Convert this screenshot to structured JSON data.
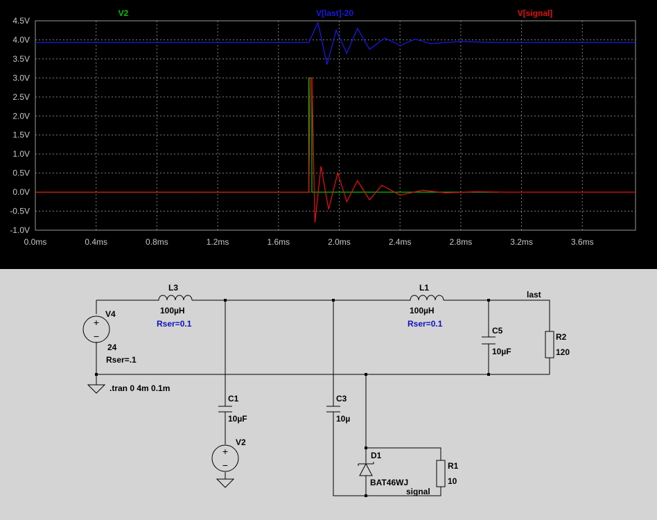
{
  "waveform": {
    "traces": [
      {
        "name": "V2",
        "color": "#00c000"
      },
      {
        "name": "V[last]-20",
        "color": "#1818e0"
      },
      {
        "name": "V[signal]",
        "color": "#e01010"
      }
    ],
    "y_ticks": [
      "4.5V",
      "4.0V",
      "3.5V",
      "3.0V",
      "2.5V",
      "2.0V",
      "1.5V",
      "1.0V",
      "0.5V",
      "0.0V",
      "-0.5V",
      "-1.0V"
    ],
    "x_ticks": [
      "0.0ms",
      "0.4ms",
      "0.8ms",
      "1.2ms",
      "1.6ms",
      "2.0ms",
      "2.4ms",
      "2.8ms",
      "3.2ms",
      "3.6ms"
    ]
  },
  "chart_data": {
    "type": "line",
    "xlabel": "",
    "ylabel": "",
    "xlim": [
      0,
      3.95
    ],
    "ylim": [
      -1.0,
      4.5
    ],
    "x_unit": "ms",
    "y_unit": "V",
    "grid": true,
    "series": [
      {
        "name": "V2",
        "x": [
          0,
          1.8,
          1.8,
          1.82,
          1.82,
          3.05
        ],
        "y": [
          0,
          0,
          3.0,
          3.0,
          0,
          0
        ]
      },
      {
        "name": "V[last]-20",
        "x": [
          0,
          1.8,
          1.86,
          1.92,
          1.98,
          2.05,
          2.12,
          2.2,
          2.3,
          2.4,
          2.5,
          2.6,
          2.8,
          3.0,
          3.95
        ],
        "y": [
          3.93,
          3.93,
          4.45,
          3.35,
          4.25,
          3.65,
          4.3,
          3.75,
          4.05,
          3.85,
          4.02,
          3.9,
          3.96,
          3.93,
          3.93
        ]
      },
      {
        "name": "V[signal]",
        "x": [
          0,
          1.8,
          1.81,
          1.82,
          1.84,
          1.88,
          1.93,
          1.99,
          2.05,
          2.12,
          2.2,
          2.28,
          2.4,
          2.55,
          2.7,
          2.9,
          3.1,
          3.95
        ],
        "y": [
          0,
          0,
          3.0,
          3.0,
          -0.8,
          0.68,
          -0.45,
          0.5,
          -0.25,
          0.3,
          -0.2,
          0.18,
          -0.08,
          0.05,
          -0.02,
          0.01,
          0,
          0
        ]
      }
    ]
  },
  "schematic": {
    "components": {
      "V4": {
        "name": "V4",
        "value": "24",
        "param": "Rser=.1"
      },
      "L3": {
        "name": "L3",
        "value": "100µH",
        "param": "Rser=0.1"
      },
      "L1": {
        "name": "L1",
        "value": "100µH",
        "param": "Rser=0.1"
      },
      "C5": {
        "name": "C5",
        "value": "10µF"
      },
      "R2": {
        "name": "R2",
        "value": "120"
      },
      "C1": {
        "name": "C1",
        "value": "10µF"
      },
      "V2": {
        "name": "V2"
      },
      "C3": {
        "name": "C3",
        "value": "10µ"
      },
      "D1": {
        "name": "D1",
        "value": "BAT46WJ"
      },
      "R1": {
        "name": "R1",
        "value": "10"
      }
    },
    "nets": {
      "last": "last",
      "signal": "signal"
    },
    "directive": ".tran 0 4m 0.1m"
  }
}
